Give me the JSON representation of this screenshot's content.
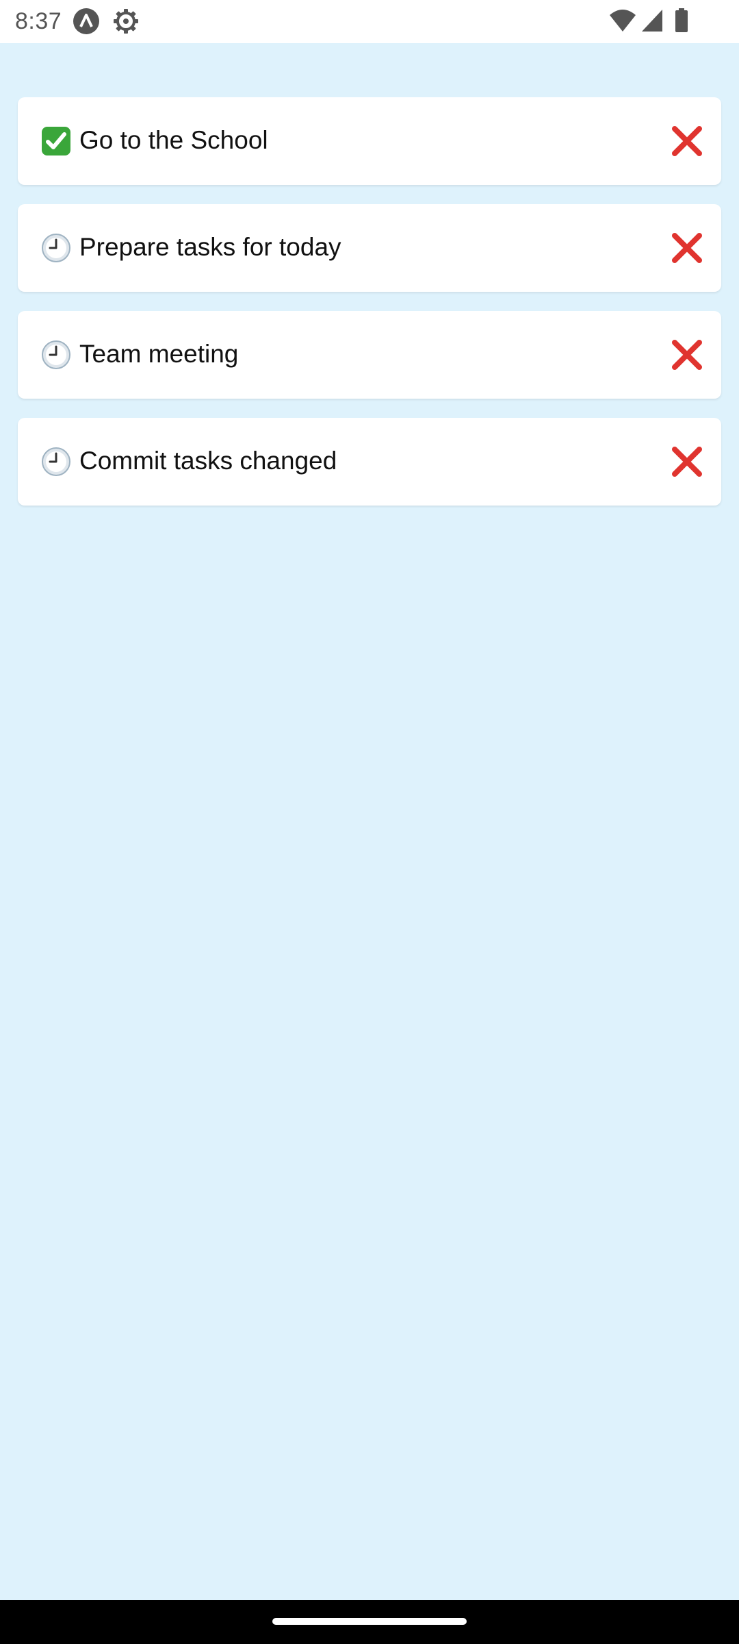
{
  "status_bar": {
    "time": "8:37",
    "left_icons": [
      "a-circle-icon",
      "gear-icon"
    ],
    "right_icons": [
      "wifi-icon",
      "signal-icon",
      "battery-icon"
    ]
  },
  "tasks": [
    {
      "title": "Go to the School",
      "status": "done",
      "status_icon": "check-mark-icon",
      "delete_icon": "close-icon"
    },
    {
      "title": "Prepare tasks for today",
      "status": "pending",
      "status_icon": "clock-icon",
      "delete_icon": "close-icon"
    },
    {
      "title": "Team meeting",
      "status": "pending",
      "status_icon": "clock-icon",
      "delete_icon": "close-icon"
    },
    {
      "title": "Commit tasks changed",
      "status": "pending",
      "status_icon": "clock-icon",
      "delete_icon": "close-icon"
    }
  ],
  "colors": {
    "background": "#def2fc",
    "card": "#ffffff",
    "done_green": "#3aa63a",
    "delete_red": "#e0342f"
  }
}
